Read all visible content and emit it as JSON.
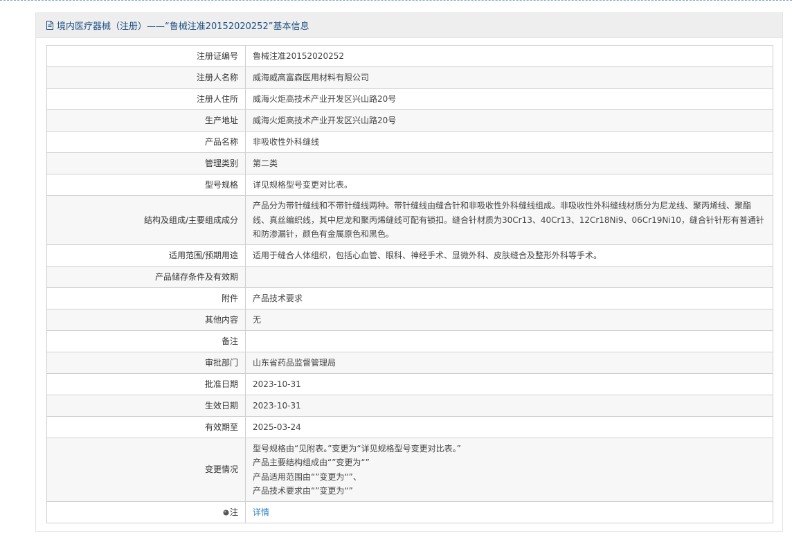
{
  "header": {
    "title": "境内医疗器械（注册）——“鲁械注准20152020252”基本信息",
    "icon": "document-icon"
  },
  "colors": {
    "header_text": "#1d4f82",
    "link": "#2b7bc0",
    "border": "#cfcfcf"
  },
  "rows": [
    {
      "label": "注册证编号",
      "value": "鲁械注准20152020252"
    },
    {
      "label": "注册人名称",
      "value": "威海威高富森医用材料有限公司"
    },
    {
      "label": "注册人住所",
      "value": "威海火炬高技术产业开发区兴山路20号"
    },
    {
      "label": "生产地址",
      "value": "威海火炬高技术产业开发区兴山路20号"
    },
    {
      "label": "产品名称",
      "value": "非吸收性外科缝线"
    },
    {
      "label": "管理类别",
      "value": "第二类"
    },
    {
      "label": "型号规格",
      "value": "详见规格型号变更对比表。"
    },
    {
      "label": "结构及组成/主要组成成分",
      "value": "产品分为带针缝线和不带针缝线两种。带针缝线由缝合针和非吸收性外科缝线组成。非吸收性外科缝线材质分为尼龙线、聚丙烯线、聚酯线、真丝编织线，其中尼龙和聚丙烯缝线可配有锁扣。缝合针材质为30Cr13、40Cr13、12Cr18Ni9、06Cr19Ni10，缝合针针形有普通针和防渗漏针，颜色有金属原色和黑色。"
    },
    {
      "label": "适用范围/预期用途",
      "value": "适用于缝合人体组织，包括心血管、眼科、神经手术、显微外科、皮肤缝合及整形外科等手术。"
    },
    {
      "label": "产品储存条件及有效期",
      "value": ""
    },
    {
      "label": "附件",
      "value": "产品技术要求"
    },
    {
      "label": "其他内容",
      "value": "无"
    },
    {
      "label": "备注",
      "value": ""
    },
    {
      "label": "审批部门",
      "value": "山东省药品监督管理局"
    },
    {
      "label": "批准日期",
      "value": "2023-10-31"
    },
    {
      "label": "生效日期",
      "value": "2023-10-31"
    },
    {
      "label": "有效期至",
      "value": "2025-03-24"
    }
  ],
  "change": {
    "label": "变更情况",
    "lines": [
      "型号规格由“见附表。”变更为“详见规格型号变更对比表。”",
      "产品主要结构组成由“”变更为“”",
      "产品适用范围由“”变更为“”、",
      "产品技术要求由“”变更为“”"
    ]
  },
  "note": {
    "label": "注",
    "icon": "info-bullet-icon",
    "link_text": "详情"
  }
}
